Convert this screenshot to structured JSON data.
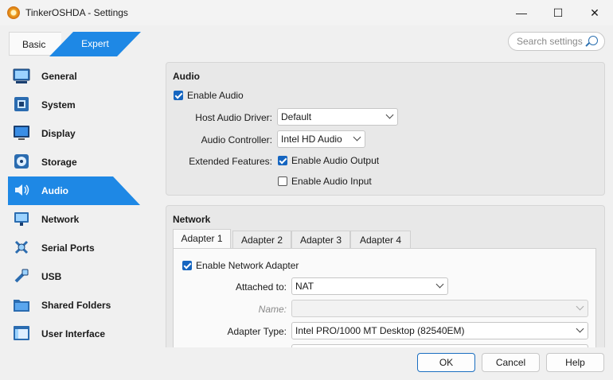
{
  "window": {
    "title": "TinkerOSHDA - Settings",
    "minimize": "—",
    "maximize": "☐",
    "close": "✕"
  },
  "mode_tabs": {
    "basic": "Basic",
    "expert": "Expert"
  },
  "search": {
    "placeholder": "Search settings"
  },
  "sidebar": {
    "items": [
      {
        "label": "General",
        "icon": "general-icon"
      },
      {
        "label": "System",
        "icon": "system-icon"
      },
      {
        "label": "Display",
        "icon": "display-icon"
      },
      {
        "label": "Storage",
        "icon": "storage-icon"
      },
      {
        "label": "Audio",
        "icon": "audio-icon",
        "active": true
      },
      {
        "label": "Network",
        "icon": "network-icon"
      },
      {
        "label": "Serial Ports",
        "icon": "serial-ports-icon"
      },
      {
        "label": "USB",
        "icon": "usb-icon"
      },
      {
        "label": "Shared Folders",
        "icon": "shared-folders-icon"
      },
      {
        "label": "User Interface",
        "icon": "user-interface-icon"
      }
    ]
  },
  "audio": {
    "title": "Audio",
    "enable_label": "Enable Audio",
    "enable_checked": true,
    "host_driver_label": "Host Audio Driver:",
    "host_driver_value": "Default",
    "controller_label": "Audio Controller:",
    "controller_value": "Intel HD Audio",
    "features_label": "Extended Features:",
    "output_label": "Enable Audio Output",
    "output_checked": true,
    "input_label": "Enable Audio Input",
    "input_checked": false
  },
  "network": {
    "title": "Network",
    "tabs": [
      "Adapter 1",
      "Adapter 2",
      "Adapter 3",
      "Adapter 4"
    ],
    "active_tab": 0,
    "enable_label": "Enable Network Adapter",
    "enable_checked": true,
    "attached_label": "Attached to:",
    "attached_value": "NAT",
    "name_label": "Name:",
    "name_value": "",
    "adapter_type_label": "Adapter Type:",
    "adapter_type_value": "Intel PRO/1000 MT Desktop (82540EM)"
  },
  "buttons": {
    "ok": "OK",
    "cancel": "Cancel",
    "help": "Help"
  },
  "colors": {
    "accent": "#1e88e5",
    "checkbox": "#1565c0"
  }
}
